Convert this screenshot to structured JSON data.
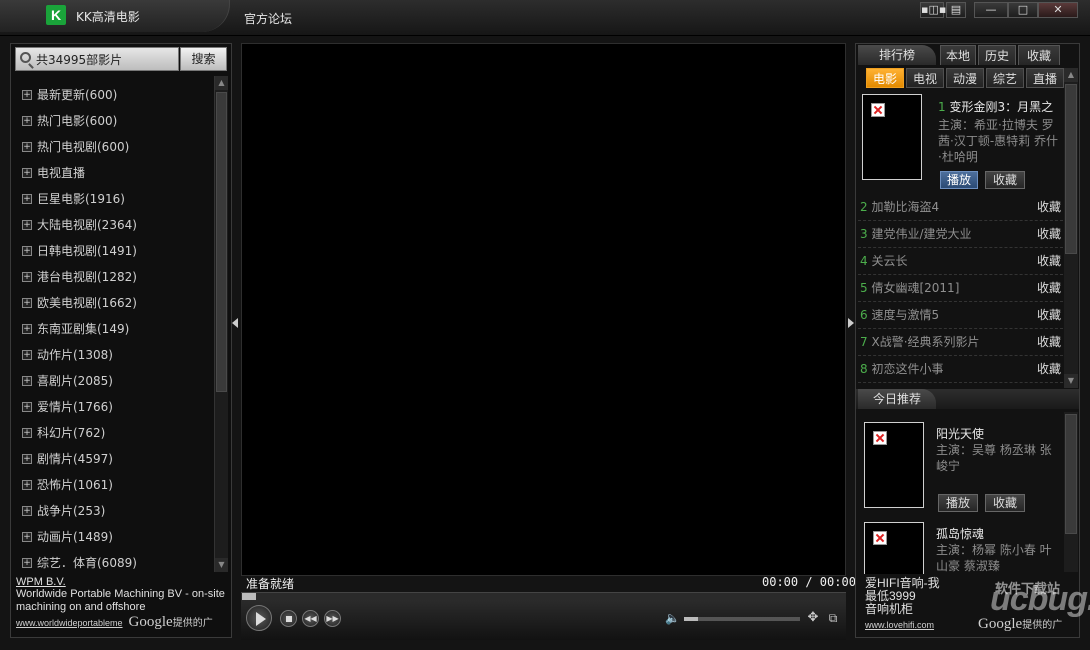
{
  "titlebar": {
    "app_title": "KK高清电影",
    "logo_letter": "K",
    "forum_link": "官方论坛",
    "buttons": {
      "mini_mode": "▪◫▪",
      "menu": "▤",
      "minimize": "—",
      "maximize": "□",
      "close": "✕"
    }
  },
  "search": {
    "placeholder": "共34995部影片",
    "value": "共34995部影片",
    "button_label": "搜索"
  },
  "categories": [
    {
      "label": "最新更新(600)"
    },
    {
      "label": "热门电影(600)"
    },
    {
      "label": "热门电视剧(600)"
    },
    {
      "label": "电视直播"
    },
    {
      "label": "巨星电影(1916)"
    },
    {
      "label": "大陆电视剧(2364)"
    },
    {
      "label": "日韩电视剧(1491)"
    },
    {
      "label": "港台电视剧(1282)"
    },
    {
      "label": "欧美电视剧(1662)"
    },
    {
      "label": "东南亚剧集(149)"
    },
    {
      "label": "动作片(1308)"
    },
    {
      "label": "喜剧片(2085)"
    },
    {
      "label": "爱情片(1766)"
    },
    {
      "label": "科幻片(762)"
    },
    {
      "label": "剧情片(4597)"
    },
    {
      "label": "恐怖片(1061)"
    },
    {
      "label": "战争片(253)"
    },
    {
      "label": "动画片(1489)"
    },
    {
      "label": "综艺．体育(6089)"
    }
  ],
  "left_ad": {
    "title": "WPM B.V.",
    "text": "Worldwide Portable Machining BV - on-site machining on and offshore",
    "url": "www.worldwideportableme",
    "google": "Google",
    "provided": "提供的广"
  },
  "player": {
    "status": "准备就绪",
    "time": "00:00 / 00:00",
    "volume_percent": 12
  },
  "right": {
    "tabs": {
      "rank": "排行榜",
      "local": "本地",
      "history": "历史",
      "favorites": "收藏"
    },
    "subtabs": [
      {
        "label": "电影",
        "active": true
      },
      {
        "label": "电视",
        "active": false
      },
      {
        "label": "动漫",
        "active": false
      },
      {
        "label": "综艺",
        "active": false
      },
      {
        "label": "直播",
        "active": false
      }
    ],
    "featured": {
      "num": "1",
      "title": "变形金刚3：月黑之",
      "cast": "主演：希亚·拉博夫 罗茜·汉丁顿-惠特莉 乔什·杜哈明",
      "play": "播放",
      "fav": "收藏"
    },
    "rank_list": [
      {
        "num": "2",
        "name": "加勒比海盗4",
        "fav": "收藏"
      },
      {
        "num": "3",
        "name": "建党伟业/建党大业",
        "fav": "收藏"
      },
      {
        "num": "4",
        "name": "关云长",
        "fav": "收藏"
      },
      {
        "num": "5",
        "name": "倩女幽魂[2011]",
        "fav": "收藏"
      },
      {
        "num": "6",
        "name": "速度与激情5",
        "fav": "收藏"
      },
      {
        "num": "7",
        "name": "X战警·经典系列影片",
        "fav": "收藏"
      },
      {
        "num": "8",
        "name": "初恋这件小事",
        "fav": "收藏"
      }
    ],
    "today": {
      "tab": "今日推荐",
      "items": [
        {
          "title": "阳光天使",
          "cast": "主演：吴尊 杨丞琳 张峻宁",
          "play": "播放",
          "fav": "收藏"
        },
        {
          "title": "孤岛惊魂",
          "cast": "主演：杨幂 陈小春 叶山豪 蔡淑臻"
        }
      ]
    },
    "ad": {
      "line1": "爱HIFI音响-我",
      "line2": "最低3999",
      "line3": "音响机柜",
      "url": "www.lovehifi.com",
      "google": "Google",
      "provided": "提供的广"
    },
    "watermark": "ucbug.cc",
    "watermark_sub": "软件下载站"
  }
}
